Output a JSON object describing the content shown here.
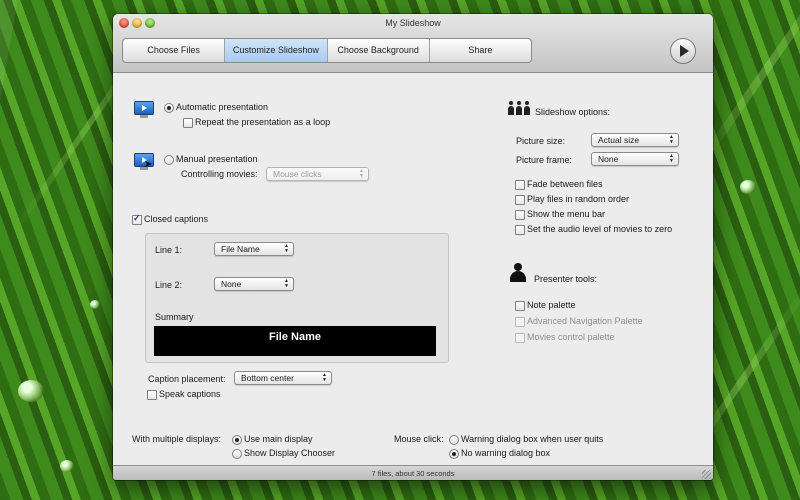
{
  "window": {
    "title": "My Slideshow"
  },
  "toolbar": {
    "tabs": [
      {
        "label": "Choose Files",
        "active": false
      },
      {
        "label": "Customize Slideshow",
        "active": true
      },
      {
        "label": "Choose Background",
        "active": false
      },
      {
        "label": "Share",
        "active": false
      }
    ],
    "play_icon": "play-icon"
  },
  "presentation": {
    "automatic_label": "Automatic presentation",
    "automatic_selected": true,
    "loop_label": "Repeat the presentation as a loop",
    "loop_checked": false,
    "manual_label": "Manual presentation",
    "manual_selected": false,
    "controlling_label": "Controlling movies:",
    "controlling_value": "Mouse clicks"
  },
  "captions": {
    "enabled_label": "Closed captions",
    "enabled_checked": true,
    "line1_label": "Line 1:",
    "line1_value": "File Name",
    "line2_label": "Line 2:",
    "line2_value": "None",
    "summary_label": "Summary",
    "preview_text": "File Name",
    "placement_label": "Caption placement:",
    "placement_value": "Bottom center",
    "speak_label": "Speak captions",
    "speak_checked": false
  },
  "slideshow_options": {
    "heading": "Slideshow options:",
    "picture_size_label": "Picture size:",
    "picture_size_value": "Actual size",
    "picture_frame_label": "Picture frame:",
    "picture_frame_value": "None",
    "checkboxes": [
      {
        "label": "Fade between files",
        "checked": false
      },
      {
        "label": "Play files in random order",
        "checked": false
      },
      {
        "label": "Show the menu bar",
        "checked": false
      },
      {
        "label": "Set the audio level of movies to zero",
        "checked": false
      }
    ]
  },
  "presenter_tools": {
    "heading": "Presenter tools:",
    "items": [
      {
        "label": "Note palette",
        "checked": false,
        "disabled": false
      },
      {
        "label": "Advanced Navigation Palette",
        "checked": false,
        "disabled": true
      },
      {
        "label": "Movies control palette",
        "checked": false,
        "disabled": true
      }
    ]
  },
  "displays": {
    "label": "With multiple displays:",
    "options": [
      {
        "label": "Use main display",
        "selected": true
      },
      {
        "label": "Show Display Chooser",
        "selected": false
      }
    ]
  },
  "mouse_click": {
    "label": "Mouse click:",
    "options": [
      {
        "label": "Warning dialog box when user quits",
        "selected": false
      },
      {
        "label": "No warning dialog box",
        "selected": true
      }
    ]
  },
  "status": {
    "text": "7 files, about 30 seconds"
  }
}
